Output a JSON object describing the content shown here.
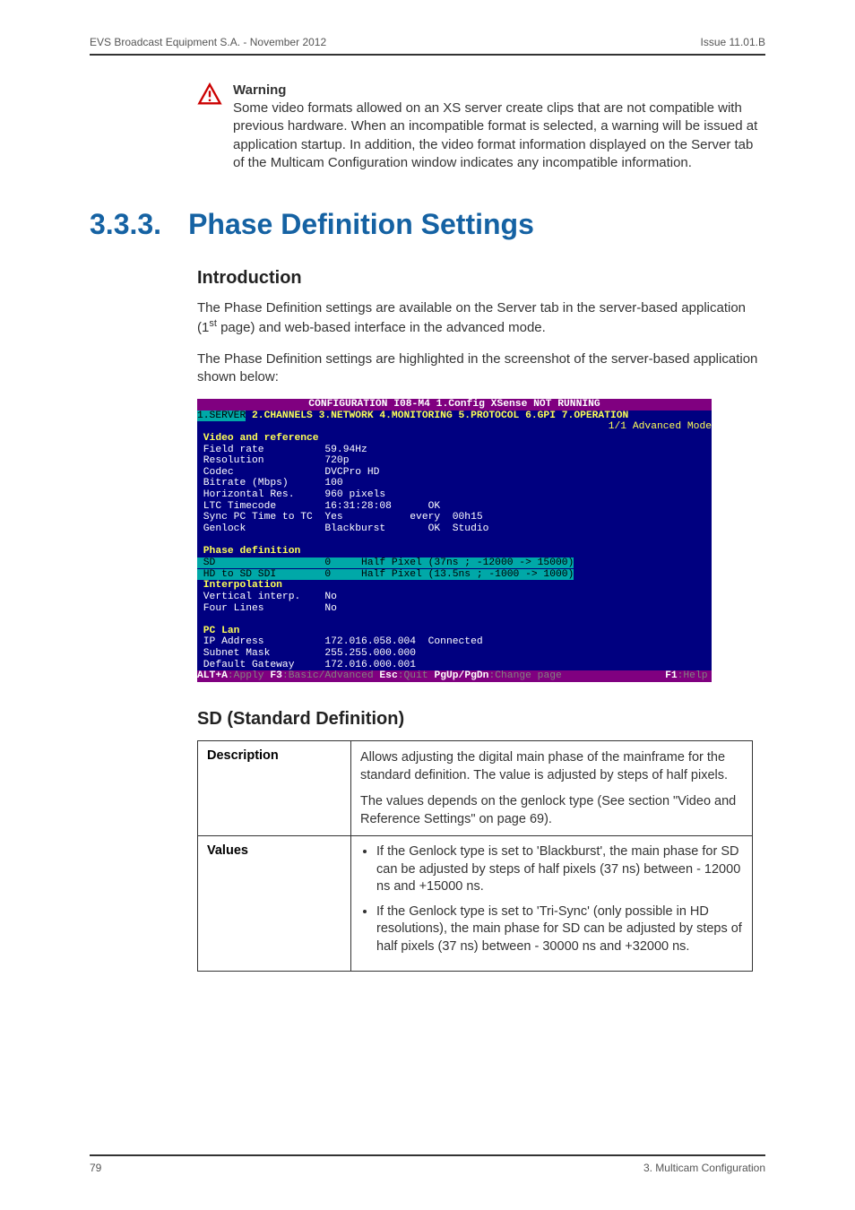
{
  "header": {
    "left": "EVS Broadcast Equipment S.A. - November 2012",
    "right": "Issue 11.01.B"
  },
  "warning": {
    "title": "Warning",
    "text": "Some video formats allowed on an XS server create clips that are not compatible with previous hardware. When an incompatible format is selected, a warning will be issued at application startup. In addition, the video format information displayed on the Server tab of the Multicam Configuration window indicates any incompatible information."
  },
  "section": {
    "number": "3.3.3.",
    "title": "Phase Definition Settings"
  },
  "intro": {
    "heading": "Introduction",
    "p1a": "The Phase Definition settings are available on the Server tab in the server-based application (1",
    "p1sup": "st",
    "p1b": " page) and web-based interface in the advanced mode.",
    "p2": "The Phase Definition settings are highlighted in the screenshot of the server-based application shown below:"
  },
  "terminal": {
    "title": "CONFIGURATION I08-M4 1.Config XSense NOT RUNNING",
    "tabs": {
      "selected": "1.SERVER",
      "rest": " 2.CHANNELS 3.NETWORK 4.MONITORING 5.PROTOCOL 6.GPI 7.OPERATION"
    },
    "mode": "1/1 Advanced Mode",
    "video_ref_header": " Video and reference",
    "rows": {
      "field_rate": " Field rate          59.94Hz",
      "resolution": " Resolution          720p",
      "codec": " Codec               DVCPro HD",
      "bitrate": " Bitrate (Mbps)      100",
      "hres": " Horizontal Res.     960 pixels",
      "ltc": " LTC Timecode        16:31:28:08      OK",
      "sync": " Sync PC Time to TC  Yes           every  00h15",
      "genlock": " Genlock             Blackburst       OK  Studio"
    },
    "phase_header": " Phase definition",
    "phase": {
      "sd": " SD                  0     Half Pixel (37ns ; -12000 -> 15000)",
      "hdsd": " HD to SD SDI        0     Half Pixel (13.5ns ; -1000 -> 1000)"
    },
    "interp_header": " Interpolation",
    "interp": {
      "vert": " Vertical interp.    No",
      "four": " Four Lines          No"
    },
    "pclan_header": " PC Lan",
    "pclan": {
      "ip": " IP Address          172.016.058.004  Connected",
      "mask": " Subnet Mask         255.255.000.000",
      "gw": " Default Gateway     172.016.000.001"
    },
    "footer": {
      "k1": "ALT+A",
      "t1": ":Apply ",
      "k2": "F3",
      "t2": ":Basic/Advanced ",
      "k3": "Esc",
      "t3": ":Quit ",
      "k4": "PgUp/PgDn",
      "t4": ":Change page",
      "spacer": "                 ",
      "k5": "F1",
      "t5": ":Help"
    }
  },
  "sd_section": {
    "heading": "SD (Standard Definition)",
    "desc_label": "Description",
    "desc_p1": "Allows adjusting the digital main phase of the mainframe for the standard definition. The value is adjusted by steps of half pixels.",
    "desc_p2": "The values depends on the genlock type (See section \"Video and Reference Settings\" on page 69).",
    "values_label": "Values",
    "values": {
      "b1": "If the Genlock type is set to 'Blackburst', the main phase for SD can be adjusted by steps of half pixels (37 ns) between - 12000 ns and +15000 ns.",
      "b2": "If the Genlock type is set to 'Tri-Sync' (only possible in HD resolutions), the main phase for SD can be adjusted by steps of half pixels (37 ns) between - 30000 ns and +32000 ns."
    }
  },
  "footer": {
    "left": "79",
    "right": "3. Multicam Configuration"
  }
}
